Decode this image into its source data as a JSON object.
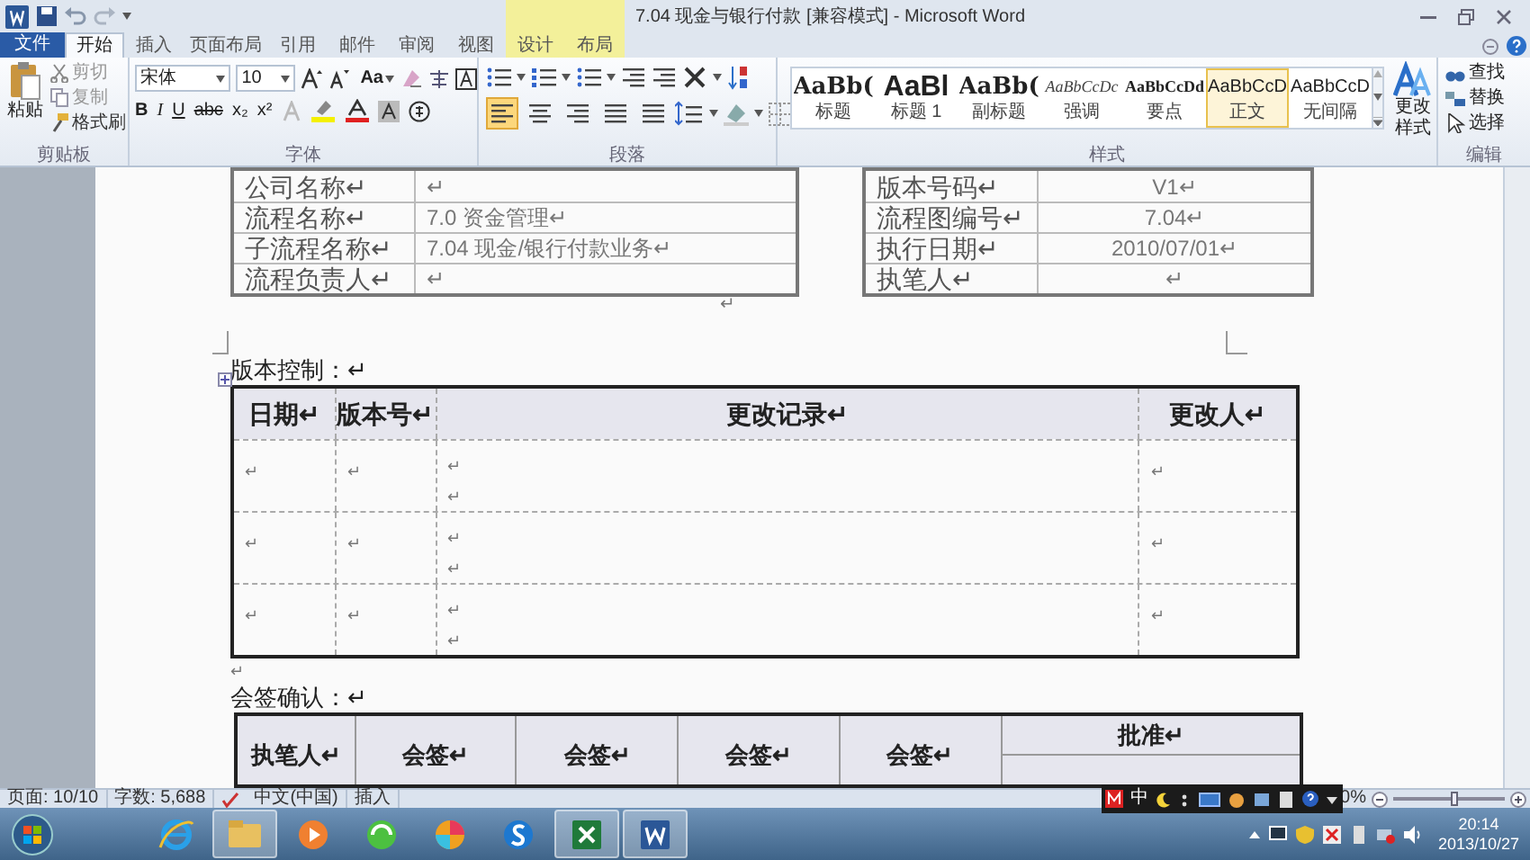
{
  "title_bar": {
    "title": "7.04 现金与银行付款 [兼容模式] - Microsoft Word"
  },
  "file_tab": "文件",
  "tabs": [
    {
      "label": "开始",
      "selected": true,
      "kind": "normal"
    },
    {
      "label": "插入",
      "selected": false,
      "kind": "normal"
    },
    {
      "label": "页面布局",
      "selected": false,
      "kind": "normal"
    },
    {
      "label": "引用",
      "selected": false,
      "kind": "normal"
    },
    {
      "label": "邮件",
      "selected": false,
      "kind": "normal"
    },
    {
      "label": "审阅",
      "selected": false,
      "kind": "normal"
    },
    {
      "label": "视图",
      "selected": false,
      "kind": "normal"
    },
    {
      "label": "设计",
      "selected": false,
      "kind": "contextual"
    },
    {
      "label": "布局",
      "selected": false,
      "kind": "contextual"
    }
  ],
  "clipboard": {
    "label": "剪贴板",
    "paste": "粘贴",
    "cut": "剪切",
    "copy": "复制",
    "format_painter": "格式刷"
  },
  "font": {
    "label": "字体",
    "name": "宋体",
    "size": "10",
    "change_case": "Aa",
    "format_buttons": [
      "B",
      "I",
      "U",
      "abc",
      "x₂",
      "x²"
    ]
  },
  "paragraph": {
    "label": "段落",
    "align_buttons": [
      {
        "selected": true
      },
      {
        "selected": false
      },
      {
        "selected": false
      },
      {
        "selected": false
      },
      {
        "selected": false
      }
    ]
  },
  "styles": {
    "label": "样式",
    "change_styles": "更改样式",
    "items": [
      {
        "preview": "AaBb(",
        "label": "标题",
        "kind": "title",
        "selected": false
      },
      {
        "preview": "AaBl",
        "label": "标题 1",
        "kind": "heading",
        "selected": false
      },
      {
        "preview": "AaBb(",
        "label": "副标题",
        "kind": "subtitle",
        "selected": false
      },
      {
        "preview": "AaBbCcDc",
        "label": "强调",
        "kind": "emphasis",
        "selected": false
      },
      {
        "preview": "AaBbCcDd",
        "label": "要点",
        "kind": "strong",
        "selected": false
      },
      {
        "preview": "AaBbCcD",
        "label": "正文",
        "kind": "normal",
        "selected": true
      },
      {
        "preview": "AaBbCcD",
        "label": "无间隔",
        "kind": "normal",
        "selected": false
      }
    ]
  },
  "editing": {
    "label": "编辑",
    "find": "查找",
    "replace": "替换",
    "select": "选择"
  },
  "document": {
    "info_tables": [
      {
        "rows": [
          [
            "公司名称↵",
            "↵"
          ],
          [
            "流程名称↵",
            "7.0  资金管理↵"
          ],
          [
            "子流程名称↵",
            "7.04  现金/银行付款业务↵"
          ],
          [
            "流程负责人↵",
            "↵"
          ]
        ]
      },
      {
        "rows": [
          [
            "版本号码↵",
            "V1↵"
          ],
          [
            "流程图编号↵",
            "7.04↵"
          ],
          [
            "执行日期↵",
            "2010/07/01↵"
          ],
          [
            "执笔人↵",
            "↵"
          ]
        ]
      }
    ],
    "spacer_mark": "↵",
    "version_control": {
      "heading": "版本控制：↵",
      "columns": [
        "日期↵",
        "版本号↵",
        "更改记录↵",
        "更改人↵"
      ],
      "rows": [
        [
          "↵",
          "↵",
          "↵\n↵",
          "↵"
        ],
        [
          "↵",
          "↵",
          "↵\n↵",
          "↵"
        ],
        [
          "↵",
          "↵",
          "↵\n↵",
          "↵"
        ]
      ]
    },
    "after_mark": "↵",
    "sign_off": {
      "heading": "会签确认：↵",
      "columns": [
        "执笔人↵",
        "会签↵",
        "会签↵",
        "会签↵",
        "会签↵",
        "批准↵"
      ]
    }
  },
  "status_bar": {
    "page": "页面: 10/10",
    "words": "字数: 5,688",
    "language": "中文(中国)",
    "mode": "插入",
    "zoom": "0%",
    "zoom_slider": {
      "level": 0.55
    },
    "ime": "中"
  },
  "taskbar": {
    "apps": [
      {
        "kind": "ie",
        "running": false
      },
      {
        "kind": "explorer",
        "running": true
      },
      {
        "kind": "media",
        "running": false
      },
      {
        "kind": "green",
        "running": false
      },
      {
        "kind": "ball",
        "running": false
      },
      {
        "kind": "sogou",
        "running": false
      },
      {
        "kind": "excel",
        "running": true
      },
      {
        "kind": "word",
        "running": true
      }
    ],
    "time": "20:14",
    "date": "2013/10/27"
  }
}
